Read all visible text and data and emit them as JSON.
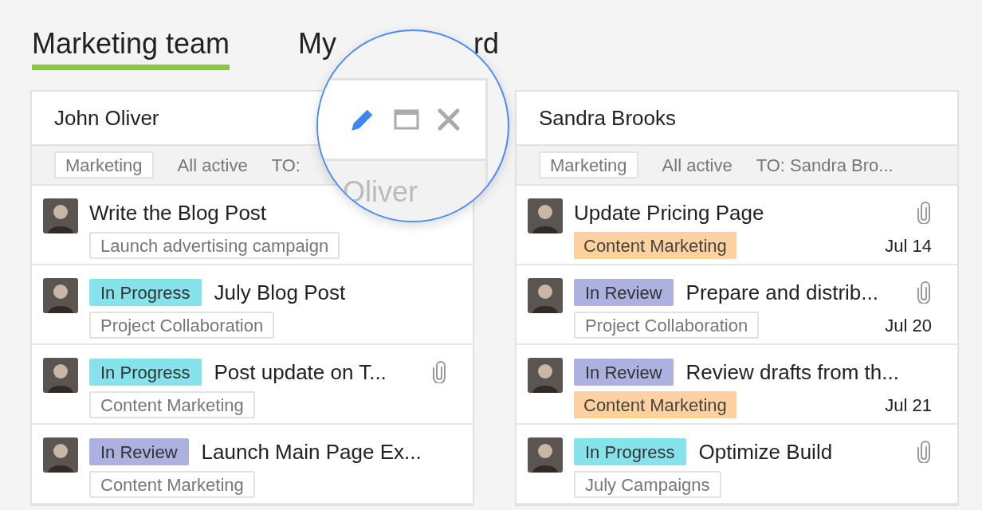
{
  "tabs": [
    {
      "label_parts": [
        "Marketing team"
      ],
      "selected": true
    },
    {
      "label_parts": [
        "My",
        "rd"
      ],
      "selected": false
    }
  ],
  "columns": [
    {
      "name": "John Oliver",
      "filters": [
        {
          "label": "Marketing",
          "selected": true
        },
        {
          "label": "All active",
          "selected": false
        },
        {
          "label": "TO:",
          "selected": false
        }
      ],
      "tasks": [
        {
          "title": "Write the Blog Post",
          "attachment": false,
          "tag": {
            "label": "Launch advertising campaign",
            "kind": "outline"
          }
        },
        {
          "status": {
            "label": "In Progress",
            "color": "#86e3eb"
          },
          "title": "July Blog Post",
          "attachment": false,
          "tag": {
            "label": "Project Collaboration",
            "kind": "outline"
          }
        },
        {
          "status": {
            "label": "In Progress",
            "color": "#86e3eb"
          },
          "title": "Post update on T...",
          "attachment": true,
          "tag": {
            "label": "Content Marketing",
            "kind": "outline"
          }
        },
        {
          "status": {
            "label": "In Review",
            "color": "#acb1e0"
          },
          "title": "Launch Main Page Ex...",
          "attachment": false,
          "tag": {
            "label": "Content Marketing",
            "kind": "outline"
          }
        }
      ]
    },
    {
      "name": "Sandra Brooks",
      "filters": [
        {
          "label": "Marketing",
          "selected": true
        },
        {
          "label": "All active",
          "selected": false
        },
        {
          "label": "TO: Sandra Bro...",
          "selected": false
        }
      ],
      "tasks": [
        {
          "title": "Update Pricing Page",
          "attachment": true,
          "tag": {
            "label": "Content Marketing",
            "kind": "filled",
            "color": "#ffd19e"
          },
          "date": "Jul 14"
        },
        {
          "status": {
            "label": "In Review",
            "color": "#acb1e0"
          },
          "title": "Prepare and distrib...",
          "attachment": true,
          "tag": {
            "label": "Project Collaboration",
            "kind": "outline"
          },
          "date": "Jul 20"
        },
        {
          "status": {
            "label": "In Review",
            "color": "#acb1e0"
          },
          "title": "Review drafts from th...",
          "attachment": false,
          "tag": {
            "label": "Content Marketing",
            "kind": "filled",
            "color": "#ffd19e"
          },
          "date": "Jul 21"
        },
        {
          "status": {
            "label": "In Progress",
            "color": "#86e3eb"
          },
          "title": "Optimize Build",
          "attachment": true,
          "tag": {
            "label": "July Campaigns",
            "kind": "outline"
          }
        }
      ]
    }
  ],
  "magnifier": {
    "caption": "Oliver"
  }
}
